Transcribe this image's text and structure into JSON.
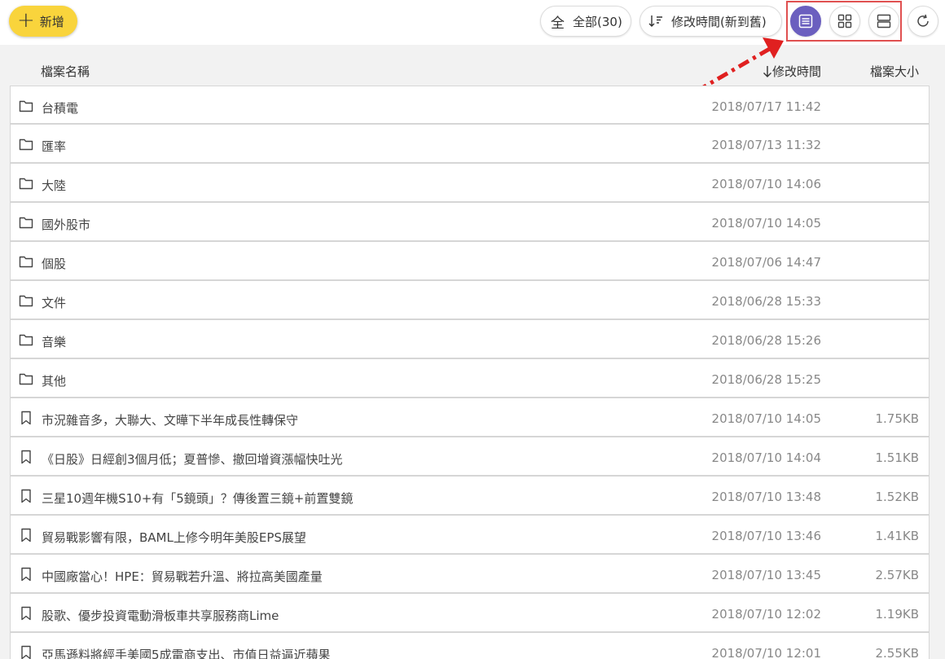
{
  "toolbar": {
    "add_label": "新增",
    "filter_label": "全部(30)",
    "filter_icon": "全",
    "sort_label": "修改時間(新到舊)"
  },
  "columns": {
    "name": "檔案名稱",
    "time": "修改時間",
    "size": "檔案大小"
  },
  "colors": {
    "accent": "#6b5fbf",
    "add_button": "#f9d43c",
    "highlight": "#e05050"
  },
  "items": [
    {
      "type": "folder",
      "name": "台積電",
      "time": "2018/07/17 11:42",
      "size": ""
    },
    {
      "type": "folder",
      "name": "匯率",
      "time": "2018/07/13 11:32",
      "size": ""
    },
    {
      "type": "folder",
      "name": "大陸",
      "time": "2018/07/10 14:06",
      "size": ""
    },
    {
      "type": "folder",
      "name": "國外股市",
      "time": "2018/07/10 14:05",
      "size": ""
    },
    {
      "type": "folder",
      "name": "個股",
      "time": "2018/07/06 14:47",
      "size": ""
    },
    {
      "type": "folder",
      "name": "文件",
      "time": "2018/06/28 15:33",
      "size": ""
    },
    {
      "type": "folder",
      "name": "音樂",
      "time": "2018/06/28 15:26",
      "size": ""
    },
    {
      "type": "folder",
      "name": "其他",
      "time": "2018/06/28 15:25",
      "size": ""
    },
    {
      "type": "bookmark",
      "name": "市況雜音多，大聯大、文曄下半年成長性轉保守",
      "time": "2018/07/10 14:05",
      "size": "1.75KB"
    },
    {
      "type": "bookmark",
      "name": "《日股》日經創3個月低；夏普慘、撤回增資漲幅快吐光",
      "time": "2018/07/10 14:04",
      "size": "1.51KB"
    },
    {
      "type": "bookmark",
      "name": "三星10週年機S10+有「5鏡頭」？傳後置三鏡+前置雙鏡",
      "time": "2018/07/10 13:48",
      "size": "1.52KB"
    },
    {
      "type": "bookmark",
      "name": "貿易戰影響有限，BAML上修今明年美股EPS展望",
      "time": "2018/07/10 13:46",
      "size": "1.41KB"
    },
    {
      "type": "bookmark",
      "name": "中國廠當心！HPE：貿易戰若升溫、將拉高美國產量",
      "time": "2018/07/10 13:45",
      "size": "2.57KB"
    },
    {
      "type": "bookmark",
      "name": "股歌、優步投資電動滑板車共享服務商Lime",
      "time": "2018/07/10 12:02",
      "size": "1.19KB"
    },
    {
      "type": "bookmark",
      "name": "亞馬遜料將經手美國5成電商支出、市值日益逼近蘋果",
      "time": "2018/07/10 12:01",
      "size": "2.55KB"
    }
  ]
}
